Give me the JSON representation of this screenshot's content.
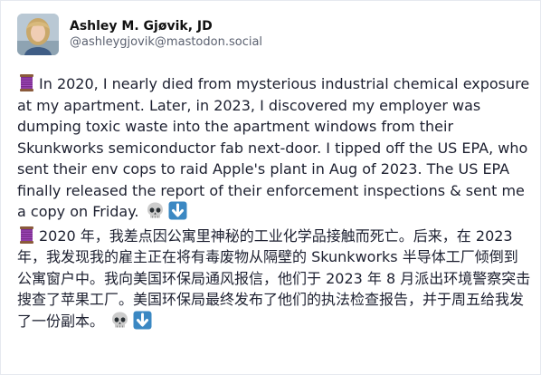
{
  "account": {
    "display_name": "Ashley M. Gjøvik, JD",
    "handle": "@ashleygjovik@mastodon.social"
  },
  "post": {
    "paragraph_en": "In 2020, I nearly died from mysterious industrial chemical exposure at my apartment. Later, in 2023, I discovered my employer was dumping toxic waste into the apartment windows from their Skunkworks semiconductor fab next-door. I tipped off the US EPA, who sent their env cops to raid Apple's plant in Aug of 2023. The US EPA finally released the report of their enforcement inspections & sent me a copy on Friday.",
    "paragraph_zh": "2020 年，我差点因公寓里神秘的工业化学品接触而死亡。后来，在 2023 年，我发现我的雇主正在将有毒废物从隔壁的 Skunkworks 半导体工厂倾倒到公寓窗户中。我向美国环保局通风报信，他们于 2023 年 8 月派出环境警察突击搜查了苹果工厂。美国环保局最终发布了他们的执法检查报告，并于周五给我发了一份副本。"
  },
  "icons": {
    "leading": "thread-spool-icon",
    "trailing": [
      "skull-icon",
      "down-arrow-icon"
    ]
  },
  "colors": {
    "spool": "#7b2d8e",
    "arrow_button": "#3b88c3",
    "skull": "#cccccc",
    "handle": "#5b6170"
  }
}
